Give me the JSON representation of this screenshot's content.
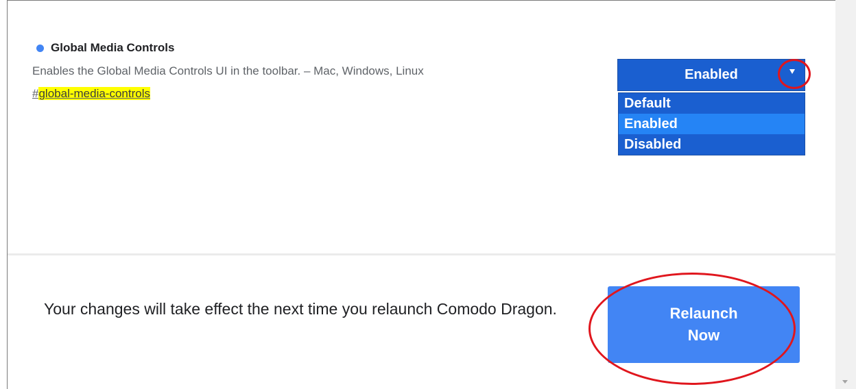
{
  "flag": {
    "title": "Global Media Controls",
    "description": "Enables the Global Media Controls UI in the toolbar. – Mac, Windows, Linux",
    "link_prefix": "#",
    "link_text": "global-media-controls"
  },
  "select": {
    "selected": "Enabled",
    "options": [
      "Default",
      "Enabled",
      "Disabled"
    ],
    "highlighted": "Enabled"
  },
  "footer": {
    "message": "Your changes will take effect the next time you relaunch Comodo Dragon.",
    "relaunch_line1": "Relaunch",
    "relaunch_line2": "Now"
  },
  "colors": {
    "accent": "#4285f4",
    "select_bg": "#1a5fd0",
    "highlight": "#ffff00",
    "annotation": "#e0161d"
  },
  "icons": {
    "dot": "blue-dot-icon",
    "caret": "dropdown-caret-icon",
    "scroll": "scroll-down-arrow-icon"
  }
}
